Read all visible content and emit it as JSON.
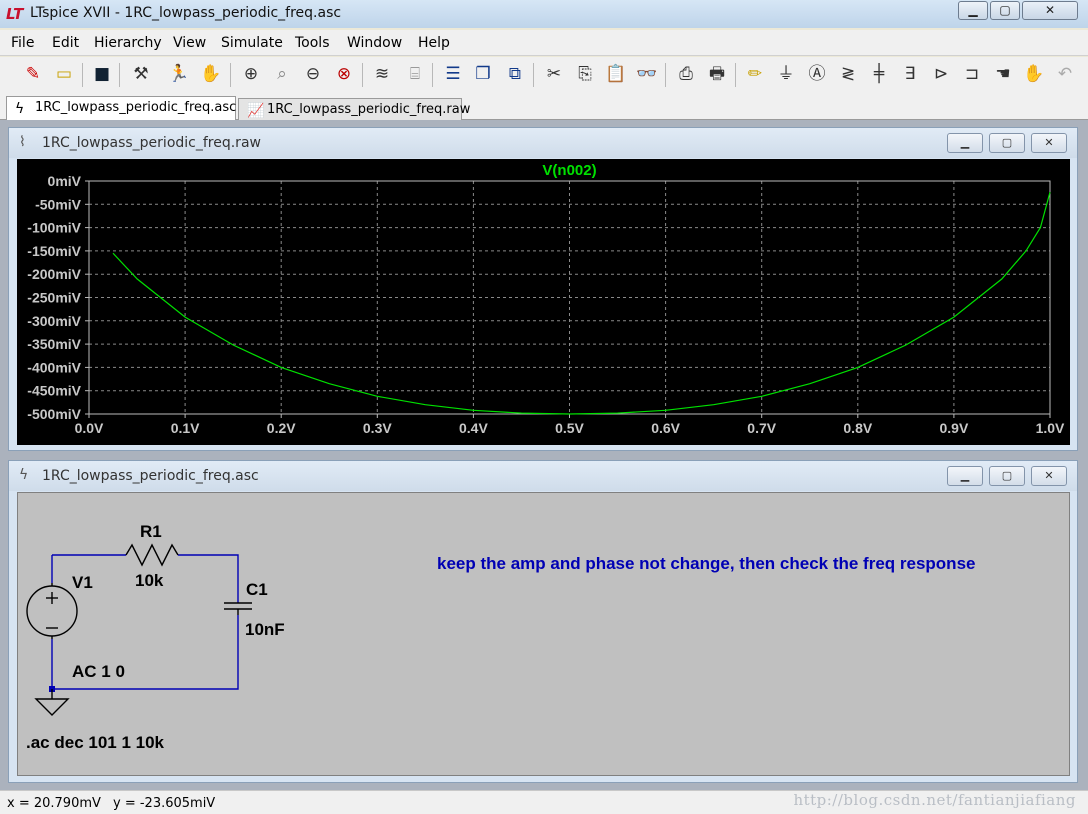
{
  "window": {
    "title": "LTspice XVII - 1RC_lowpass_periodic_freq.asc",
    "logo": "LT"
  },
  "menu": [
    "File",
    "Edit",
    "Hierarchy",
    "View",
    "Simulate",
    "Tools",
    "Window",
    "Help"
  ],
  "toolbar_icons": [
    "new-schematic-icon",
    "open-folder-icon",
    "save-icon",
    "hammer-icon",
    "run-icon",
    "pan-hand-icon",
    "zoom-in-icon",
    "zoom-area-icon",
    "zoom-out-icon",
    "zoom-fit-icon",
    "autorange-icon",
    "plot-settings-icon",
    "tile-horizontal-icon",
    "cascade-icon",
    "tile-vertical-icon",
    "cut-icon",
    "copy-icon",
    "paste-icon",
    "find-icon",
    "print-icon",
    "print-setup-icon",
    "wire-icon",
    "ground-icon",
    "label-icon",
    "resistor-icon",
    "capacitor-icon",
    "inductor-icon",
    "diode-icon",
    "component-icon",
    "move-hand-icon",
    "drag-hand-icon",
    "undo-icon"
  ],
  "tabs": [
    {
      "label": "1RC_lowpass_periodic_freq.asc",
      "icon": "schematic-icon",
      "active": true
    },
    {
      "label": "1RC_lowpass_periodic_freq.raw",
      "icon": "waveform-icon",
      "active": false
    }
  ],
  "plot_window": {
    "title": "1RC_lowpass_periodic_freq.raw",
    "trace_color": "#00e000"
  },
  "chart_data": {
    "type": "line",
    "title": "V(n002)",
    "xlabel": "",
    "ylabel": "",
    "xlim": [
      0.0,
      1.0
    ],
    "ylim": [
      -500,
      0
    ],
    "x_ticks": [
      "0.0V",
      "0.1V",
      "0.2V",
      "0.3V",
      "0.4V",
      "0.5V",
      "0.6V",
      "0.7V",
      "0.8V",
      "0.9V",
      "1.0V"
    ],
    "y_ticks": [
      "0miV",
      "-50miV",
      "-100miV",
      "-150miV",
      "-200miV",
      "-250miV",
      "-300miV",
      "-350miV",
      "-400miV",
      "-450miV",
      "-500miV"
    ],
    "grid": true,
    "series": [
      {
        "name": "V(n002)",
        "x": [
          0.025,
          0.05,
          0.1,
          0.15,
          0.2,
          0.25,
          0.3,
          0.35,
          0.4,
          0.45,
          0.5,
          0.55,
          0.6,
          0.65,
          0.7,
          0.75,
          0.8,
          0.85,
          0.9,
          0.95,
          0.975,
          0.99,
          1.0
        ],
        "y": [
          -155,
          -210,
          -292,
          -352,
          -400,
          -435,
          -462,
          -480,
          -492,
          -498,
          -500,
          -498,
          -492,
          -480,
          -462,
          -435,
          -400,
          -352,
          -292,
          -210,
          -150,
          -100,
          -24
        ]
      }
    ]
  },
  "schematic_window": {
    "title": "1RC_lowpass_periodic_freq.asc",
    "components": {
      "r1_name": "R1",
      "r1_value": "10k",
      "c1_name": "C1",
      "c1_value": "10nF",
      "v1_name": "V1",
      "v1_value": "AC 1 0"
    },
    "directive": ".ac dec 101 1 10k",
    "comment": "keep the amp and phase not change, then check the freq response",
    "comment_color": "#0000b4",
    "wire_color": "#0000b4"
  },
  "status": {
    "x": "x = 20.790mV",
    "y": "y = -23.605miV",
    "watermark": "http://blog.csdn.net/fantianjiafiang"
  }
}
